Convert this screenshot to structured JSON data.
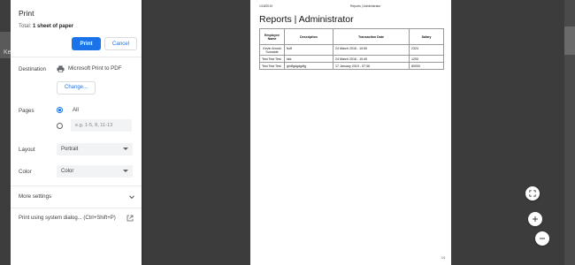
{
  "panel": {
    "title": "Print",
    "total_label": "Total:",
    "total_value": "1 sheet of paper",
    "print_label": "Print",
    "cancel_label": "Cancel",
    "destination_label": "Destination",
    "destination_value": "Microsoft Print to PDF",
    "change_label": "Change...",
    "pages_label": "Pages",
    "pages_all_label": "All",
    "pages_placeholder": "e.g. 1-5, 8, 11-13",
    "layout_label": "Layout",
    "layout_value": "Portrait",
    "color_label": "Color",
    "color_value": "Color",
    "more_settings_label": "More settings",
    "system_dialog_label": "Print using system dialog... (Ctrl+Shift+P)"
  },
  "background": {
    "left_letter": "Ke"
  },
  "preview": {
    "header_date": "1/18/2019",
    "header_title": "Reports | Administrator",
    "title": "Reports | Administrator",
    "page_number": "1/1",
    "columns": [
      "Employee Name",
      "Description",
      "Transaction Date",
      "Salary"
    ],
    "rows": [
      [
        "Kevin Arnold Sumalde",
        "fsdf",
        "24 March 2016 - 10:50",
        "2324"
      ],
      [
        "Test Test Test",
        "kkk",
        "24 March 2016 - 10:40",
        "1200"
      ],
      [
        "Test Test Test",
        "ghdfgdgdgdfg",
        "17 January 2019 - 07:36",
        "80000"
      ]
    ]
  },
  "colors": {
    "accent": "#1a73e8",
    "backdrop": "#3c3c3c"
  }
}
